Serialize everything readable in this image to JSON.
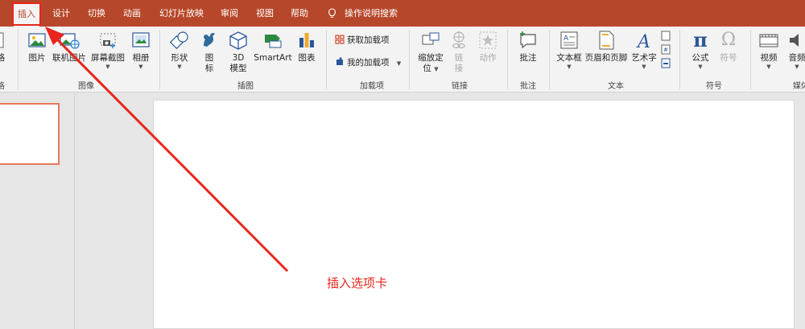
{
  "tabs": [
    {
      "label": "插入"
    },
    {
      "label": "设计"
    },
    {
      "label": "切换"
    },
    {
      "label": "动画"
    },
    {
      "label": "幻灯片放映"
    },
    {
      "label": "审阅"
    },
    {
      "label": "视图"
    },
    {
      "label": "帮助"
    }
  ],
  "tell_me": "操作说明搜索",
  "ribbon": {
    "cut_left_label": "格",
    "images": {
      "label": "图像",
      "picture": "图片",
      "online_picture": "联机图片",
      "screenshot": "屏幕截图",
      "album": "相册"
    },
    "illustrations": {
      "label": "插图",
      "shapes": "形状",
      "icons_1": "图",
      "icons_2": "标",
      "models_1": "3D",
      "models_2": "模型",
      "smartart": "SmartArt",
      "chart": "图表"
    },
    "addins": {
      "label": "加载项",
      "get": "获取加载项",
      "mine": "我的加载项"
    },
    "links": {
      "label": "链接",
      "zoom_1": "缩放定",
      "zoom_2": "位",
      "link_1": "链",
      "link_2": "接",
      "action": "动作"
    },
    "comments": {
      "label": "批注",
      "comment": "批注"
    },
    "text": {
      "label": "文本",
      "textbox": "文本框",
      "header_footer": "页眉和页脚",
      "wordart": "艺术字"
    },
    "symbols": {
      "label": "符号",
      "equation": "公式",
      "symbol": "符号"
    },
    "media": {
      "label": "媒体",
      "video": "视频",
      "audio": "音频"
    }
  },
  "annotation": "插入选项卡",
  "colors": {
    "accent": "#b7472a",
    "annotation": "#e8261b"
  }
}
